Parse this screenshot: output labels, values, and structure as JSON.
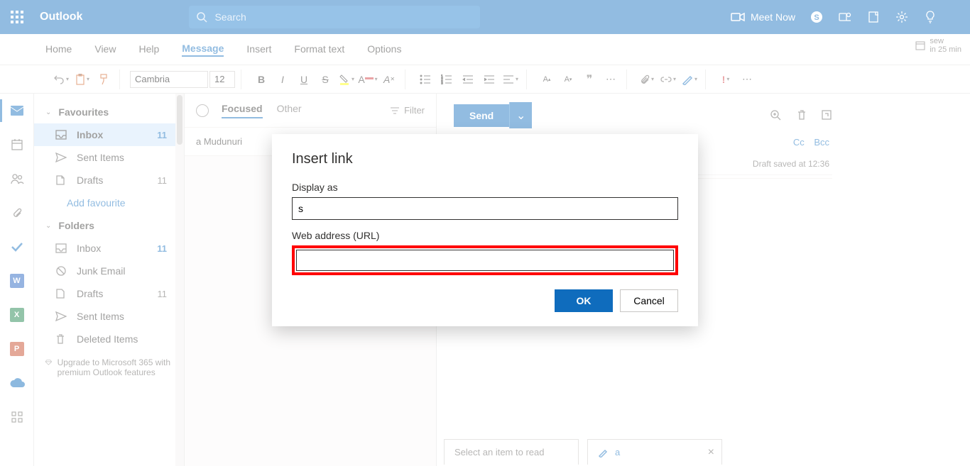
{
  "app": {
    "brand": "Outlook",
    "search_placeholder": "Search",
    "meet_now": "Meet Now"
  },
  "reminder": {
    "title": "sew",
    "time": "in 25 min"
  },
  "menu": {
    "home": "Home",
    "view": "View",
    "help": "Help",
    "message": "Message",
    "insert": "Insert",
    "format": "Format text",
    "options": "Options"
  },
  "ribbon": {
    "font": "Cambria",
    "size": "12"
  },
  "sidebar": {
    "sections": {
      "favourites": "Favourites",
      "folders": "Folders"
    },
    "items": {
      "inbox": "Inbox",
      "inbox_count": "11",
      "sent": "Sent Items",
      "drafts": "Drafts",
      "drafts_count": "11",
      "add_fav": "Add favourite",
      "inbox2": "Inbox",
      "inbox2_count": "11",
      "junk": "Junk Email",
      "drafts2": "Drafts",
      "drafts2_count": "11",
      "sent2": "Sent Items",
      "deleted": "Deleted Items"
    },
    "upgrade": "Upgrade to Microsoft 365 with premium Outlook features"
  },
  "msglist": {
    "focused": "Focused",
    "other": "Other",
    "filter": "Filter",
    "preview_name": "a Mudunuri"
  },
  "compose": {
    "send": "Send",
    "cc": "Cc",
    "bcc": "Bcc",
    "draft": "Draft saved at 12:36"
  },
  "bottom": {
    "select": "Select an item to read",
    "tab2": "a"
  },
  "dialog": {
    "title": "Insert link",
    "display_as_label": "Display as",
    "display_as_value": "s",
    "url_label": "Web address (URL)",
    "url_value": "",
    "ok": "OK",
    "cancel": "Cancel"
  }
}
